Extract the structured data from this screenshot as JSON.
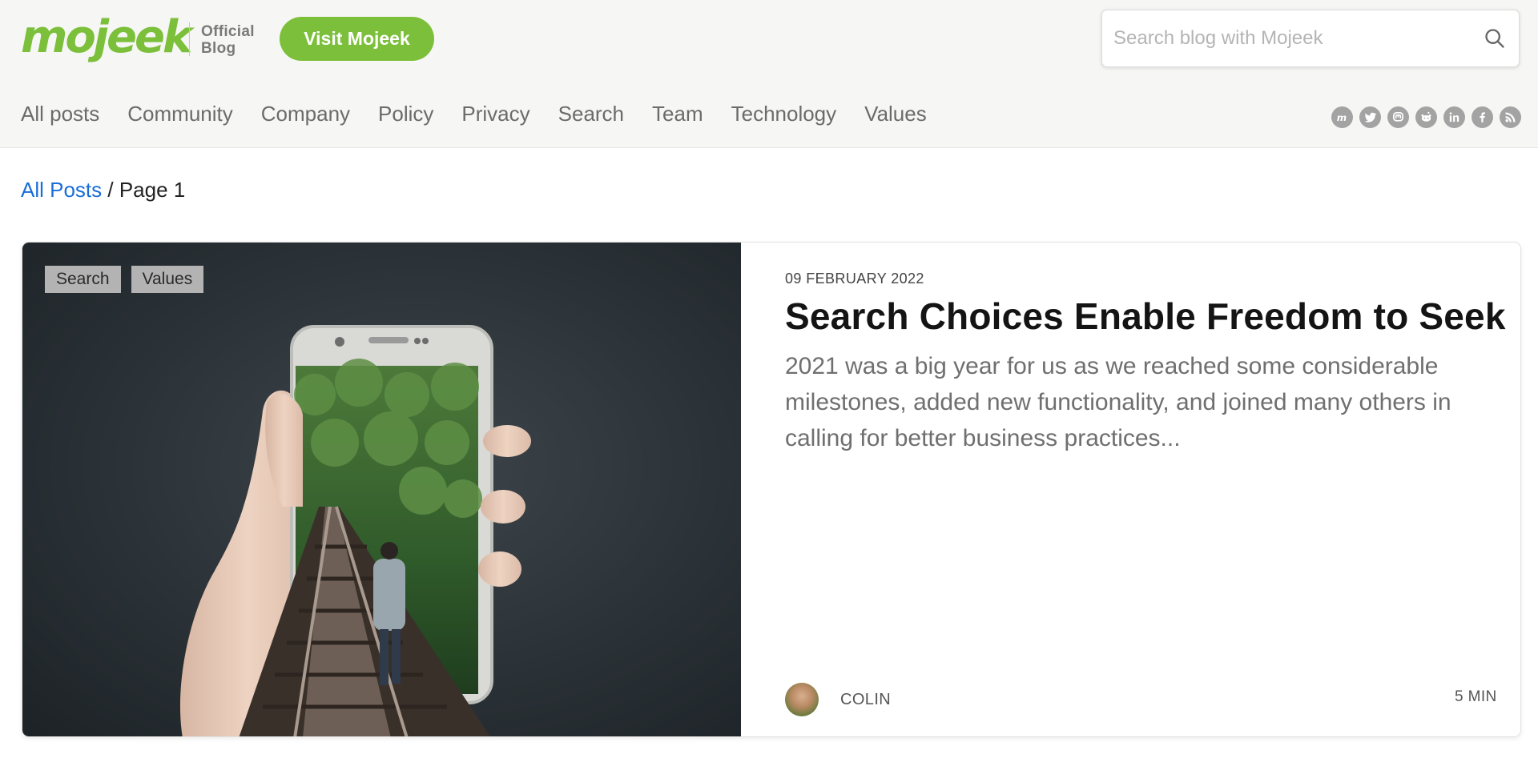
{
  "header": {
    "logo_text": "mojeek",
    "official_line1": "Official",
    "official_line2": "Blog",
    "visit_button": "Visit Mojeek",
    "search_placeholder": "Search blog with Mojeek",
    "search_icon": "search-icon"
  },
  "nav": {
    "items": [
      {
        "label": "All posts"
      },
      {
        "label": "Community"
      },
      {
        "label": "Company"
      },
      {
        "label": "Policy"
      },
      {
        "label": "Privacy"
      },
      {
        "label": "Search"
      },
      {
        "label": "Team"
      },
      {
        "label": "Technology"
      },
      {
        "label": "Values"
      }
    ],
    "social_icons": [
      "mojeek-icon",
      "twitter-icon",
      "mastodon-icon",
      "reddit-icon",
      "linkedin-icon",
      "facebook-icon",
      "rss-icon"
    ]
  },
  "breadcrumb": {
    "link": "All Posts",
    "separator": " / ",
    "current": "Page 1"
  },
  "post": {
    "tags": [
      "Search",
      "Values"
    ],
    "date": "09 FEBRUARY 2022",
    "title": "Search Choices Enable Freedom to Seek",
    "excerpt": "2021 was a big year for us as we reached some considerable milestones, added new functionality, and joined many others in calling for better business practices...",
    "author": "COLIN",
    "read_time": "5 MIN"
  },
  "colors": {
    "brand_green": "#7bbf3a",
    "link_blue": "#1a6ed8",
    "header_bg": "#f6f6f4"
  }
}
